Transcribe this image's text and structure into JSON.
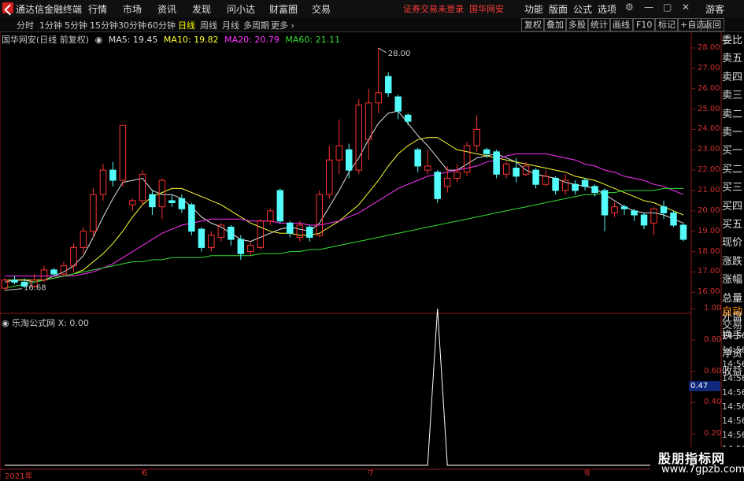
{
  "app": {
    "title": "通达信金融终端"
  },
  "top_menu": [
    "行情",
    "市场",
    "资讯",
    "发现",
    "问小达",
    "财富圈",
    "交易"
  ],
  "notice": {
    "left": "证券交易未登录",
    "right": "国华网安"
  },
  "right_menu": [
    "功能",
    "版面",
    "公式",
    "选项"
  ],
  "guest": "游客",
  "period_tabs": [
    "分时",
    "1分钟",
    "5分钟",
    "15分钟",
    "30分钟",
    "60分钟",
    "日线",
    "周线",
    "月线",
    "多周期",
    "更多"
  ],
  "active_period": "日线",
  "toolbar_buttons": [
    "复权",
    "叠加",
    "多股",
    "统计",
    "画线",
    "F10",
    "标记",
    "+自选",
    "返回"
  ],
  "chart_info": {
    "name": "国华网安(日线 前复权)",
    "ma5_label": "MA5: 19.45",
    "ma10_label": "MA10: 19.82",
    "ma20_label": "MA20: 20.79",
    "ma60_label": "MA60: 21.11",
    "colors": {
      "ma5": "#e0e0e0",
      "ma10": "#ffff33",
      "ma20": "#ff33ff",
      "ma60": "#33dd33"
    }
  },
  "side_panel": [
    "委比",
    "卖五",
    "卖四",
    "卖三",
    "卖二",
    "卖一",
    "买一",
    "买二",
    "买三",
    "买四",
    "买五",
    "现价",
    "涨跌",
    "涨幅",
    "总量",
    "外盘",
    "换手",
    "净资",
    "收益"
  ],
  "indicator": {
    "title": "乐淘公式网 X: 0.00",
    "current_value": "0.47",
    "auto_trade": [
      "自动",
      "交易"
    ],
    "times": [
      "14:56",
      "14:56",
      "14:56",
      "14:56",
      "14:56",
      "14:56",
      "14:56",
      "14:56",
      "14:56"
    ]
  },
  "watermark": {
    "line1": "股朋指标网",
    "line2": "www.7gpzb.com"
  },
  "chart_data": [
    {
      "type": "candlestick",
      "ylim": [
        15.2,
        28.5
      ],
      "y_ticks": [
        "28.00",
        "27.00",
        "26.00",
        "25.00",
        "24.00",
        "23.00",
        "22.00",
        "21.00",
        "20.00",
        "19.00",
        "18.00",
        "17.00",
        "16.00"
      ],
      "annotations": {
        "high": "28.00",
        "low": "16.68"
      },
      "x_labels": [
        "2021年",
        "6",
        "7",
        "8"
      ],
      "candles": [
        [
          16.2,
          16.6,
          16.1,
          16.7
        ],
        [
          16.6,
          16.5,
          16.4,
          16.8
        ],
        [
          16.5,
          16.3,
          16.2,
          16.7
        ],
        [
          16.3,
          16.6,
          16.2,
          16.9
        ],
        [
          16.6,
          17.1,
          16.5,
          17.3
        ],
        [
          17.1,
          16.9,
          16.8,
          17.2
        ],
        [
          16.9,
          17.3,
          16.8,
          17.5
        ],
        [
          17.3,
          18.2,
          17.0,
          18.4
        ],
        [
          18.2,
          19.0,
          17.9,
          19.2
        ],
        [
          19.0,
          20.8,
          18.7,
          21.1
        ],
        [
          20.8,
          22.0,
          20.5,
          22.3
        ],
        [
          22.0,
          21.5,
          21.2,
          22.4
        ],
        [
          21.5,
          24.2,
          21.2,
          24.2
        ],
        [
          20.3,
          20.5,
          20.0,
          20.6
        ],
        [
          20.5,
          21.8,
          20.3,
          22.0
        ],
        [
          20.8,
          20.2,
          19.8,
          21.0
        ],
        [
          20.2,
          21.5,
          19.6,
          21.6
        ],
        [
          20.5,
          20.4,
          20.2,
          20.8
        ],
        [
          20.6,
          20.1,
          19.9,
          20.8
        ],
        [
          20.3,
          19.0,
          18.8,
          20.4
        ],
        [
          19.1,
          18.2,
          18.0,
          19.2
        ],
        [
          18.2,
          18.8,
          18.0,
          19.0
        ],
        [
          18.7,
          19.3,
          18.5,
          19.4
        ],
        [
          19.2,
          18.6,
          18.3,
          19.3
        ],
        [
          18.6,
          17.9,
          17.6,
          18.8
        ],
        [
          18.0,
          18.3,
          17.8,
          18.5
        ],
        [
          18.2,
          19.5,
          18.1,
          19.6
        ],
        [
          19.5,
          20.0,
          19.3,
          20.1
        ],
        [
          21.0,
          19.5,
          19.4,
          21.1
        ],
        [
          19.4,
          18.9,
          18.7,
          19.5
        ],
        [
          18.7,
          19.3,
          18.5,
          19.5
        ],
        [
          19.2,
          18.7,
          18.5,
          19.3
        ],
        [
          18.8,
          20.8,
          18.7,
          21.0
        ],
        [
          20.8,
          22.5,
          20.6,
          23.2
        ],
        [
          22.5,
          23.2,
          21.8,
          24.5
        ],
        [
          23.0,
          22.0,
          21.6,
          23.3
        ],
        [
          22.0,
          25.2,
          21.8,
          25.5
        ],
        [
          23.5,
          25.3,
          22.5,
          26.0
        ],
        [
          25.3,
          25.8,
          24.8,
          28.0
        ],
        [
          26.6,
          25.8,
          25.6,
          26.8
        ],
        [
          25.6,
          24.9,
          24.5,
          25.7
        ],
        [
          24.7,
          24.4,
          24.2,
          24.8
        ],
        [
          23.0,
          22.2,
          21.9,
          23.1
        ],
        [
          22.0,
          22.2,
          21.8,
          23.0
        ],
        [
          21.9,
          20.6,
          20.4,
          22.0
        ],
        [
          21.2,
          21.6,
          20.9,
          22.2
        ],
        [
          21.6,
          21.9,
          21.4,
          22.3
        ],
        [
          21.9,
          23.2,
          21.7,
          23.4
        ],
        [
          23.2,
          24.0,
          22.9,
          24.7
        ],
        [
          23.0,
          22.8,
          22.6,
          23.1
        ],
        [
          22.9,
          21.8,
          21.6,
          23.0
        ],
        [
          21.8,
          22.3,
          21.6,
          22.4
        ],
        [
          22.1,
          21.7,
          21.4,
          22.6
        ],
        [
          21.8,
          22.2,
          21.7,
          22.4
        ],
        [
          22.0,
          21.3,
          21.1,
          22.1
        ],
        [
          21.3,
          21.7,
          21.2,
          22.0
        ],
        [
          21.6,
          21.0,
          20.8,
          21.7
        ],
        [
          21.0,
          21.5,
          20.8,
          21.8
        ],
        [
          21.3,
          21.0,
          20.8,
          21.5
        ],
        [
          21.5,
          21.2,
          21.0,
          21.6
        ],
        [
          21.2,
          20.9,
          20.7,
          21.3
        ],
        [
          21.0,
          19.8,
          19.0,
          21.1
        ],
        [
          19.9,
          20.2,
          19.7,
          20.4
        ],
        [
          20.2,
          20.1,
          19.8,
          20.3
        ],
        [
          20.0,
          19.8,
          19.5,
          20.1
        ],
        [
          19.8,
          19.3,
          19.1,
          19.9
        ],
        [
          19.4,
          20.1,
          18.8,
          20.2
        ],
        [
          20.2,
          19.9,
          19.6,
          20.5
        ],
        [
          19.9,
          19.3,
          19.2,
          20.0
        ],
        [
          19.3,
          18.6,
          18.5,
          19.4
        ]
      ],
      "series": [
        {
          "name": "MA5",
          "values": [
            16.5,
            16.6,
            16.6,
            16.5,
            16.6,
            16.8,
            17.0,
            17.3,
            17.8,
            18.7,
            19.7,
            20.6,
            21.4,
            21.5,
            21.6,
            21.0,
            20.8,
            20.8,
            20.6,
            20.2,
            19.7,
            19.4,
            19.2,
            18.9,
            18.6,
            18.5,
            18.7,
            18.9,
            19.1,
            19.2,
            19.1,
            19.0,
            19.4,
            20.2,
            21.0,
            21.9,
            22.6,
            23.5,
            24.3,
            24.8,
            24.9,
            24.3,
            23.7,
            23.2,
            22.6,
            22.0,
            22.0,
            22.3,
            22.6,
            22.7,
            22.8,
            22.6,
            22.4,
            22.0,
            21.8,
            21.7,
            21.6,
            21.4,
            21.3,
            21.2,
            21.1,
            20.8,
            20.5,
            20.2,
            20.0,
            19.9,
            19.9,
            19.8,
            19.6,
            19.4
          ]
        },
        {
          "name": "MA10",
          "values": [
            16.6,
            16.6,
            16.6,
            16.6,
            16.6,
            16.7,
            16.8,
            16.9,
            17.1,
            17.5,
            17.9,
            18.4,
            19.0,
            19.7,
            20.3,
            20.7,
            20.9,
            21.1,
            21.1,
            20.9,
            20.7,
            20.5,
            20.3,
            20.0,
            19.7,
            19.4,
            19.2,
            19.0,
            18.9,
            18.9,
            18.8,
            18.8,
            18.9,
            19.2,
            19.5,
            19.9,
            20.3,
            20.9,
            21.5,
            22.2,
            22.8,
            23.2,
            23.5,
            23.6,
            23.6,
            23.3,
            23.0,
            22.9,
            22.8,
            22.7,
            22.6,
            22.5,
            22.4,
            22.3,
            22.2,
            22.1,
            22.0,
            21.9,
            21.7,
            21.6,
            21.5,
            21.3,
            21.1,
            20.9,
            20.7,
            20.5,
            20.4,
            20.2,
            20.0,
            19.8
          ]
        },
        {
          "name": "MA20",
          "values": [
            16.8,
            16.8,
            16.8,
            16.8,
            16.8,
            16.8,
            16.8,
            16.8,
            16.9,
            17.0,
            17.2,
            17.4,
            17.7,
            18.0,
            18.3,
            18.6,
            18.9,
            19.1,
            19.3,
            19.4,
            19.5,
            19.6,
            19.6,
            19.6,
            19.6,
            19.5,
            19.5,
            19.5,
            19.4,
            19.4,
            19.4,
            19.3,
            19.3,
            19.4,
            19.5,
            19.7,
            19.9,
            20.2,
            20.5,
            20.8,
            21.1,
            21.3,
            21.5,
            21.7,
            21.8,
            21.9,
            22.0,
            22.1,
            22.2,
            22.4,
            22.5,
            22.7,
            22.8,
            22.8,
            22.8,
            22.8,
            22.7,
            22.6,
            22.5,
            22.3,
            22.2,
            22.0,
            21.9,
            21.7,
            21.6,
            21.5,
            21.3,
            21.2,
            21.0,
            20.8
          ]
        },
        {
          "name": "MA60",
          "values": [
            16.2,
            16.3,
            16.4,
            16.5,
            16.6,
            16.7,
            16.8,
            16.9,
            17.0,
            17.1,
            17.2,
            17.3,
            17.4,
            17.5,
            17.5,
            17.6,
            17.6,
            17.7,
            17.7,
            17.7,
            17.7,
            17.8,
            17.8,
            17.8,
            17.8,
            17.8,
            17.9,
            17.9,
            17.9,
            18.0,
            18.0,
            18.1,
            18.1,
            18.2,
            18.3,
            18.4,
            18.5,
            18.6,
            18.7,
            18.8,
            18.9,
            19.0,
            19.1,
            19.2,
            19.3,
            19.4,
            19.5,
            19.6,
            19.7,
            19.8,
            19.9,
            20.0,
            20.1,
            20.2,
            20.3,
            20.4,
            20.5,
            20.6,
            20.7,
            20.8,
            20.8,
            20.9,
            20.9,
            21.0,
            21.0,
            21.0,
            21.0,
            21.1,
            21.1,
            21.1
          ]
        }
      ]
    },
    {
      "type": "line",
      "title": "乐淘公式网 X: 0.00",
      "ylim": [
        0,
        1.0
      ],
      "y_ticks": [
        "1.00",
        "0.80",
        "0.60",
        "0.40",
        "0.20"
      ],
      "series": [
        {
          "name": "X",
          "values": [
            0,
            0,
            0,
            0,
            0,
            0,
            0,
            0,
            0,
            0,
            0,
            0,
            0,
            0,
            0,
            0,
            0,
            0,
            0,
            0,
            0,
            0,
            0,
            0,
            0,
            0,
            0,
            0,
            0,
            0,
            0,
            0,
            0,
            0,
            0,
            0,
            0,
            0,
            0,
            0,
            0,
            0,
            0,
            0,
            1,
            0,
            0,
            0,
            0,
            0,
            0,
            0,
            0,
            0,
            0,
            0,
            0,
            0,
            0,
            0,
            0,
            0,
            0,
            0,
            0,
            0,
            0,
            0,
            0,
            0
          ]
        }
      ]
    }
  ]
}
